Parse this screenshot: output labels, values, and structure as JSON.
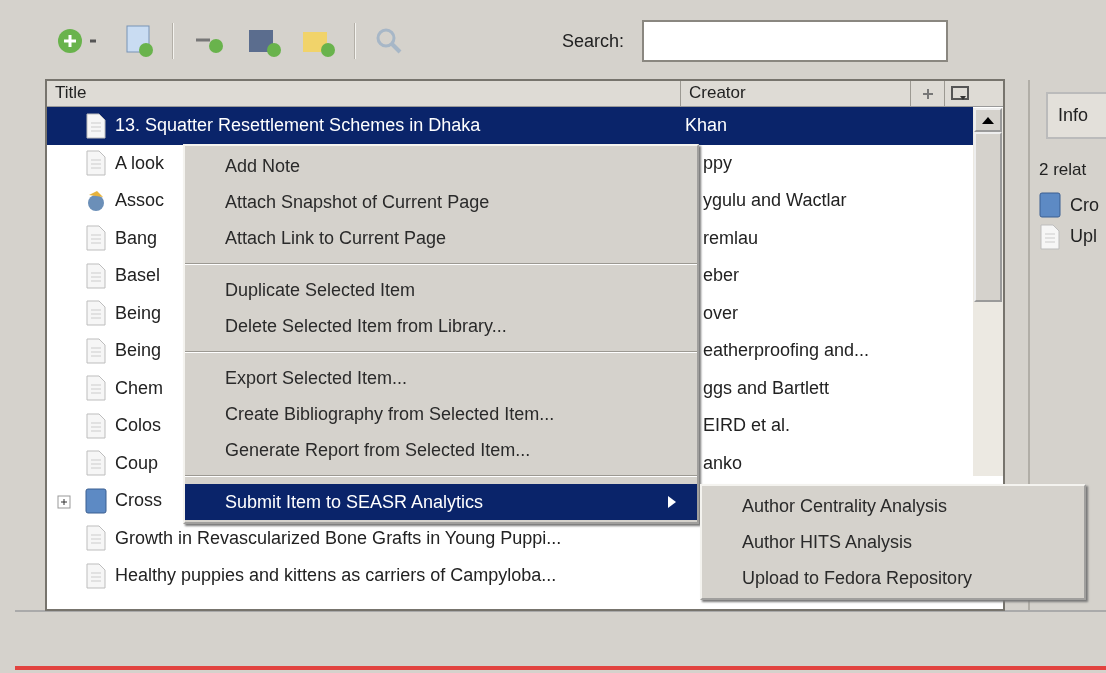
{
  "search": {
    "label": "Search:"
  },
  "table": {
    "columns": [
      "Title",
      "Creator"
    ],
    "rows": [
      {
        "title": "13. Squatter Resettlement Schemes in Dhaka",
        "creator": "Khan",
        "kind": "document",
        "selected": true
      },
      {
        "title": "A look",
        "creator": "ppy",
        "kind": "document",
        "selected": false
      },
      {
        "title": "Assoc",
        "creator": "ygulu and Wactlar",
        "kind": "webpage",
        "selected": false
      },
      {
        "title": "Bang",
        "creator": "remlau",
        "kind": "document",
        "selected": false
      },
      {
        "title": "Basel",
        "creator": "eber",
        "kind": "document",
        "selected": false
      },
      {
        "title": "Being",
        "creator": "over",
        "kind": "document",
        "selected": false
      },
      {
        "title": "Being",
        "creator": "eatherproofing and...",
        "kind": "document",
        "selected": false
      },
      {
        "title": "Chem",
        "creator": "ggs and Bartlett",
        "kind": "document",
        "selected": false
      },
      {
        "title": "Colos",
        "creator": "EIRD et al.",
        "kind": "document",
        "selected": false
      },
      {
        "title": "Coup",
        "creator": "anko",
        "kind": "document",
        "selected": false
      },
      {
        "title": "Cross",
        "kind": "book",
        "selected": false
      },
      {
        "title": "Growth in Revascularized Bone Grafts in Young Puppi...",
        "kind": "document",
        "selected": false
      },
      {
        "title": "Healthy puppies and kittens as carriers of Campyloba...",
        "kind": "document",
        "selected": false
      }
    ]
  },
  "context_menu": {
    "groups": [
      [
        {
          "label": "Add Note",
          "selected": false
        },
        {
          "label": "Attach Snapshot of Current Page",
          "selected": false
        },
        {
          "label": "Attach Link to Current Page",
          "selected": false
        }
      ],
      [
        {
          "label": "Duplicate Selected Item",
          "selected": false
        },
        {
          "label": "Delete Selected Item from Library...",
          "selected": false
        }
      ],
      [
        {
          "label": "Export Selected Item...",
          "selected": false
        },
        {
          "label": "Create Bibliography from Selected Item...",
          "selected": false
        },
        {
          "label": "Generate Report from Selected Item...",
          "selected": false
        }
      ],
      [
        {
          "label": "Submit Item to SEASR Analytics",
          "selected": true,
          "submenu": true
        }
      ]
    ],
    "submenu": [
      "Author Centrality Analysis",
      "Author HITS Analysis",
      "Upload to Fedora Repository"
    ]
  },
  "info_panel": {
    "tab": "Info",
    "heading": "2 relat",
    "related": [
      {
        "title": "Cro",
        "kind": "book"
      },
      {
        "title": "Upl",
        "kind": "document"
      }
    ]
  }
}
